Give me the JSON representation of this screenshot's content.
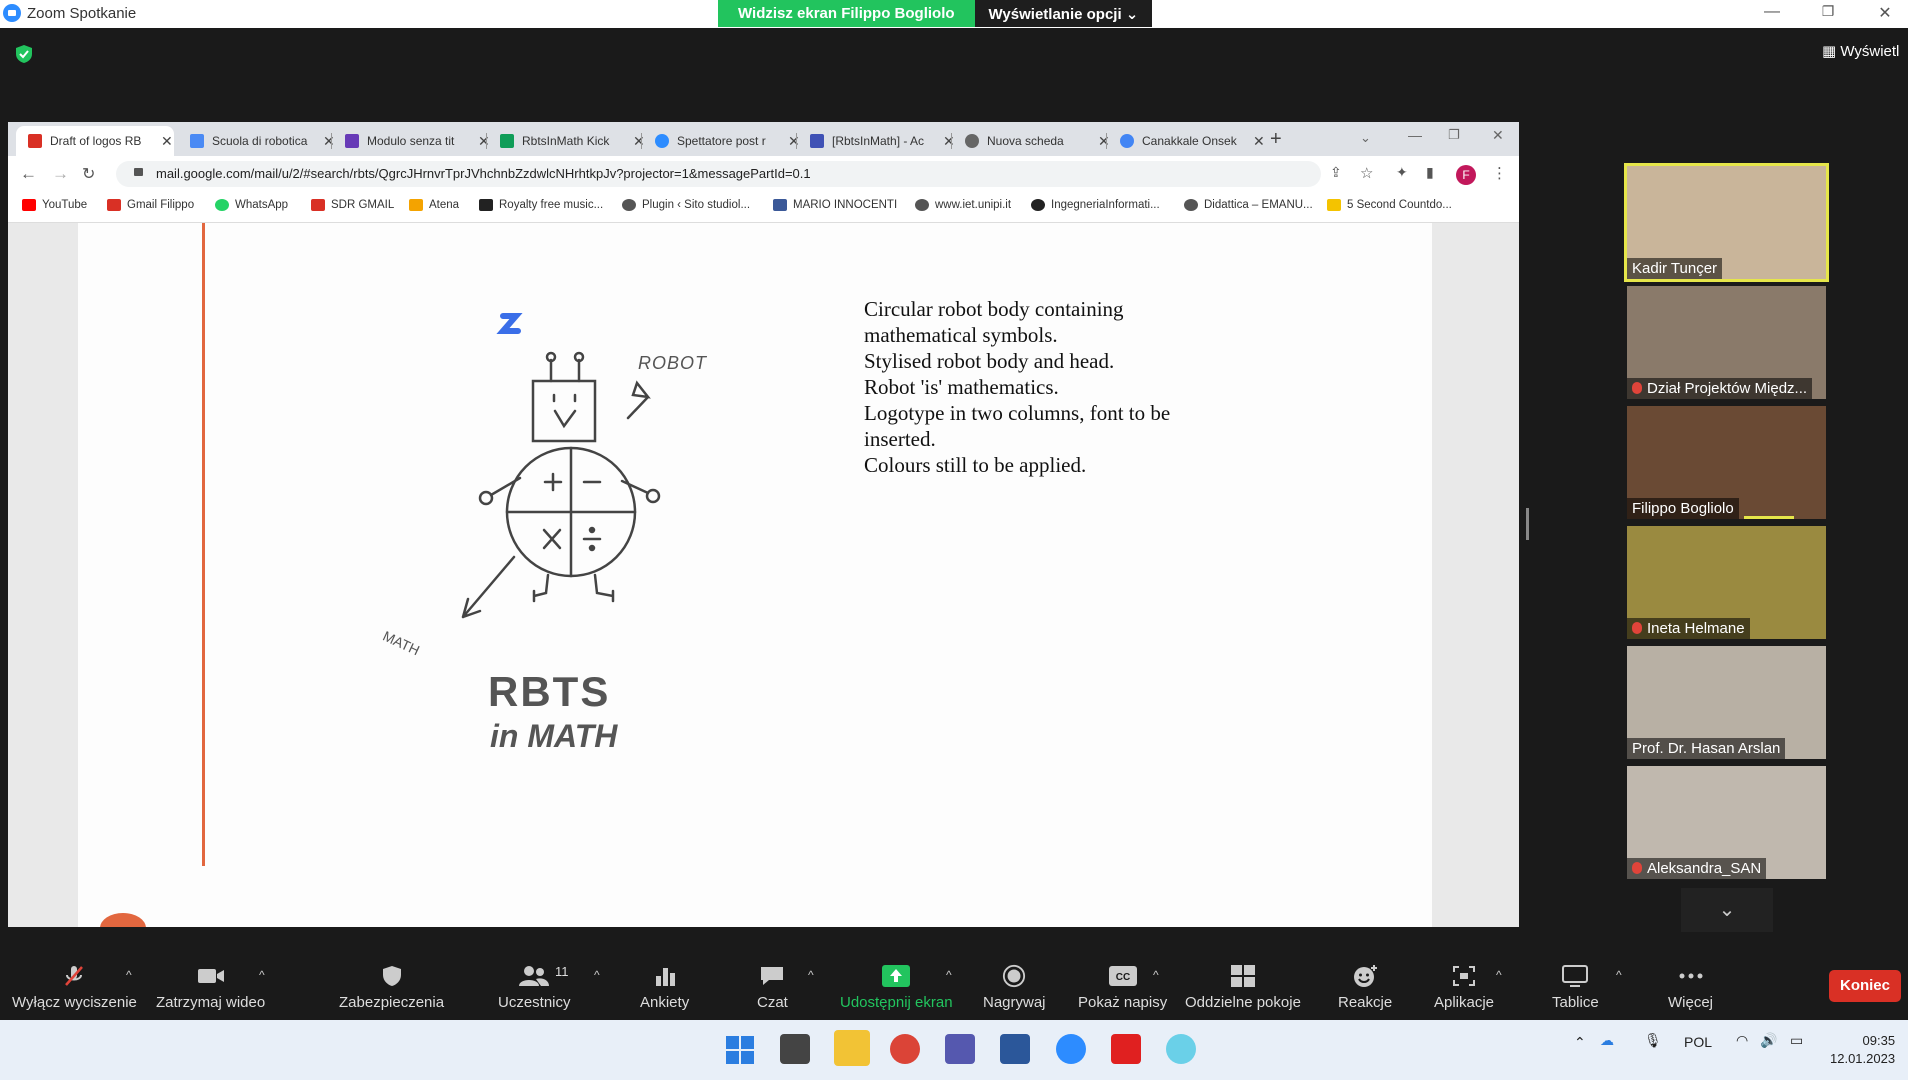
{
  "window": {
    "title": "Zoom Spotkanie"
  },
  "share_banner": {
    "status": "Widzisz ekran Filippo Bogliolo",
    "options": "Wyświetlanie opcji ⌄"
  },
  "view_button": "Wyświetl",
  "browser": {
    "tabs": [
      {
        "label": "Draft of logos RB",
        "color": "#d93025"
      },
      {
        "label": "Scuola di robotica",
        "color": "#4a8af4"
      },
      {
        "label": "Modulo senza tit",
        "color": "#673ab7"
      },
      {
        "label": "RbtsInMath Kick",
        "color": "#0f9d58"
      },
      {
        "label": "Spettatore post r",
        "color": "#2d8cff"
      },
      {
        "label": "[RbtsInMath] - Ac",
        "color": "#3f51b5"
      },
      {
        "label": "Nuova scheda",
        "color": "#666666"
      },
      {
        "label": "Canakkale Onsek",
        "color": "#4285f4"
      }
    ],
    "url": "mail.google.com/mail/u/2/#search/rbts/QgrcJHrnvrTprJVhchnbZzdwlcNHrhtkpJv?projector=1&messagePartId=0.1",
    "profile_initial": "F",
    "bookmarks": [
      {
        "label": "YouTube",
        "color": "#ff0000"
      },
      {
        "label": "Gmail Filippo",
        "color": "#d93025"
      },
      {
        "label": "WhatsApp",
        "color": "#25d366"
      },
      {
        "label": "SDR GMAIL",
        "color": "#d93025"
      },
      {
        "label": "Atena",
        "color": "#f4a300"
      },
      {
        "label": "Royalty free music...",
        "color": "#222222"
      },
      {
        "label": "Plugin ‹ Sito studiol...",
        "color": "#555555"
      },
      {
        "label": "MARIO INNOCENTI",
        "color": "#3b5998"
      },
      {
        "label": "www.iet.unipi.it",
        "color": "#555555"
      },
      {
        "label": "IngegneriaInformati...",
        "color": "#222222"
      },
      {
        "label": "Didattica – EMANU...",
        "color": "#555555"
      },
      {
        "label": "5 Second Countdo...",
        "color": "#f4c300"
      }
    ]
  },
  "slide": {
    "description": [
      "Circular robot body containing",
      "mathematical symbols.",
      "Stylised robot body and head.",
      "Robot 'is' mathematics.",
      "Logotype in two columns, font to be",
      "inserted.",
      "Colours still to be applied."
    ],
    "sketch": {
      "label_robot": "ROBOT",
      "label_math": "MATH",
      "logo_line1": "RBTS",
      "logo_line2": "in MATH"
    }
  },
  "participants": [
    {
      "name": "Kadir Tunçer",
      "muted": false,
      "active": true,
      "bg": "#c9b59a"
    },
    {
      "name": "Dział Projektów Międz...",
      "muted": true,
      "active": false,
      "bg": "#8a7a6a"
    },
    {
      "name": "Filippo Bogliolo",
      "muted": false,
      "active": false,
      "bg": "#6a4a34"
    },
    {
      "name": "Ineta Helmane",
      "muted": true,
      "active": false,
      "bg": "#9a8a40"
    },
    {
      "name": "Prof. Dr. Hasan Arslan",
      "muted": false,
      "active": false,
      "bg": "#b8b0a4"
    },
    {
      "name": "Aleksandra_SAN",
      "muted": true,
      "active": false,
      "bg": "#c0b8ae"
    }
  ],
  "toolbar": {
    "mute": "Wyłącz wyciszenie",
    "video": "Zatrzymaj wideo",
    "security": "Zabezpieczenia",
    "participants": "Uczestnicy",
    "participants_count": "11",
    "polls": "Ankiety",
    "chat": "Czat",
    "share": "Udostępnij ekran",
    "record": "Nagrywaj",
    "captions": "Pokaż napisy",
    "breakout": "Oddzielne pokoje",
    "reactions": "Reakcje",
    "apps": "Aplikacje",
    "whiteboards": "Tablice",
    "more": "Więcej",
    "end": "Koniec"
  },
  "taskbar": {
    "language": "POL",
    "time": "09:35",
    "date": "12.01.2023"
  }
}
